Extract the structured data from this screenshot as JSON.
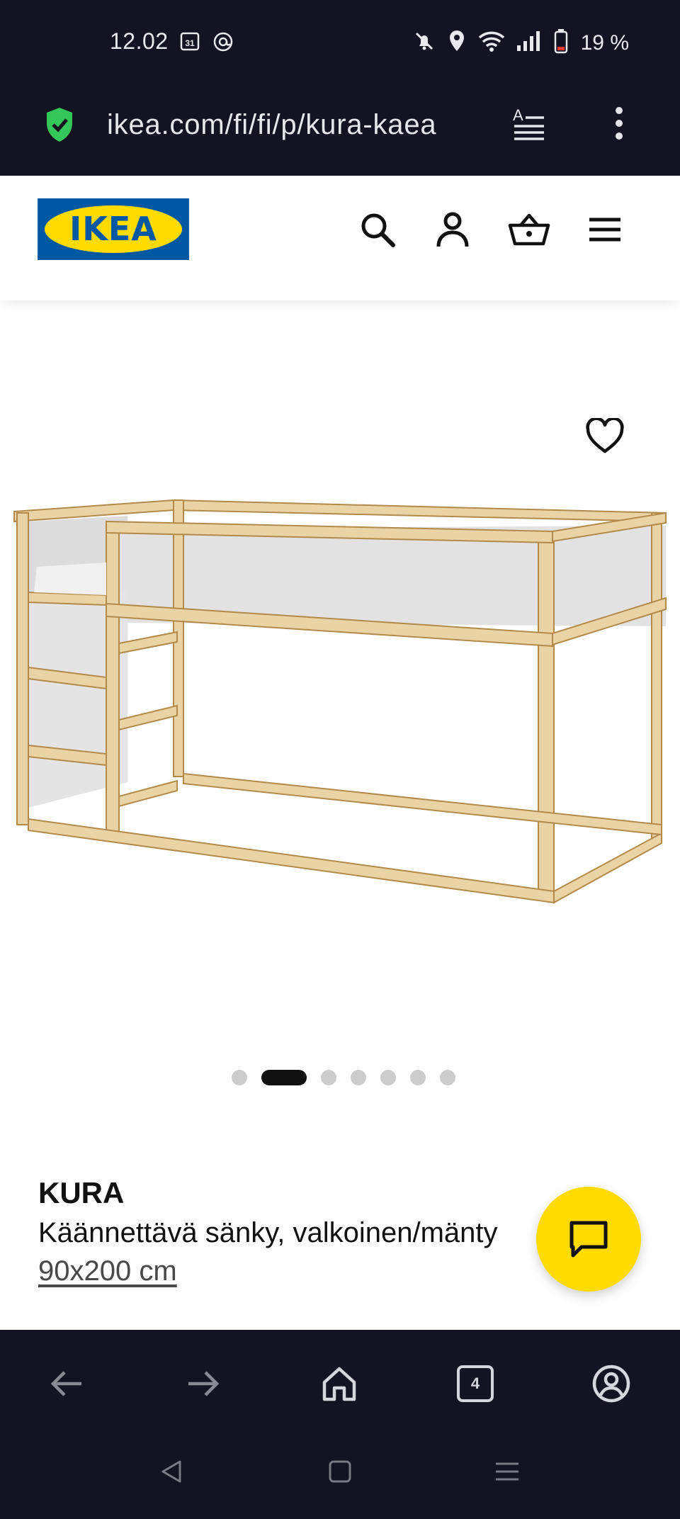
{
  "status_bar": {
    "time": "12.02",
    "calendar_badge": "31",
    "battery_percent": "19 %"
  },
  "browser": {
    "url": "ikea.com/fi/fi/p/kura-kaea",
    "tab_count": "4"
  },
  "header": {
    "logo_text": "IKEA",
    "icons": [
      "search-icon",
      "account-icon",
      "basket-icon",
      "menu-icon"
    ]
  },
  "carousel": {
    "total_images": 7,
    "active_index": 1
  },
  "product": {
    "name": "KURA",
    "description": "Käännettävä sänky, valkoinen/mänty",
    "size": "90x200 cm"
  },
  "colors": {
    "ikea_blue": "#0058a3",
    "ikea_yellow": "#ffdb00",
    "browser_chrome": "#131321"
  }
}
